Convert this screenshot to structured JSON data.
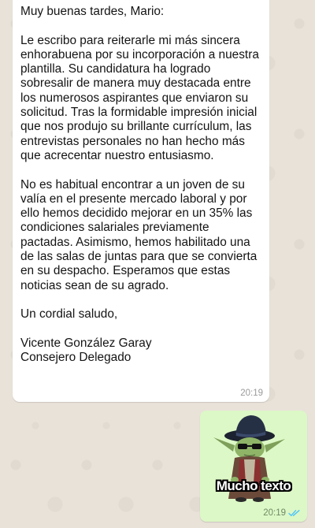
{
  "incoming_message": {
    "text": "Muy buenas tardes, Mario:\n\nLe escribo para reiterarle mi más sincera enhorabuena por su incorporación a nuestra plantilla. Su candidatura ha logrado sobresalir de manera muy destacada entre los numerosos aspirantes que enviaron su solicitud. Tras la formidable impresión inicial que nos produjo su brillante currículum, las entrevistas personales no han hecho más que acrecentar nuestro entusiasmo.\n\nNo es habitual encontrar a un joven de su valía en el presente mercado laboral y por ello hemos decidido mejorar en un 35% las condiciones salariales previamente pactadas. Asimismo, hemos habilitado una de las salas de juntas para que se convierta en su despacho. Esperamos que estas noticias sean de su agrado.\n\nUn cordial saludo,\n\nVicente González Garay\nConsejero Delegado",
    "time": "20:19"
  },
  "outgoing_message": {
    "sticker_caption": "Mucho texto",
    "time": "20:19",
    "status_icon": "double-check-read-icon"
  },
  "colors": {
    "wallpaper": "#e8e2d9",
    "incoming_bubble": "#ffffff",
    "outgoing_bubble": "#dcf8c6",
    "read_ticks": "#4fc3f7"
  }
}
